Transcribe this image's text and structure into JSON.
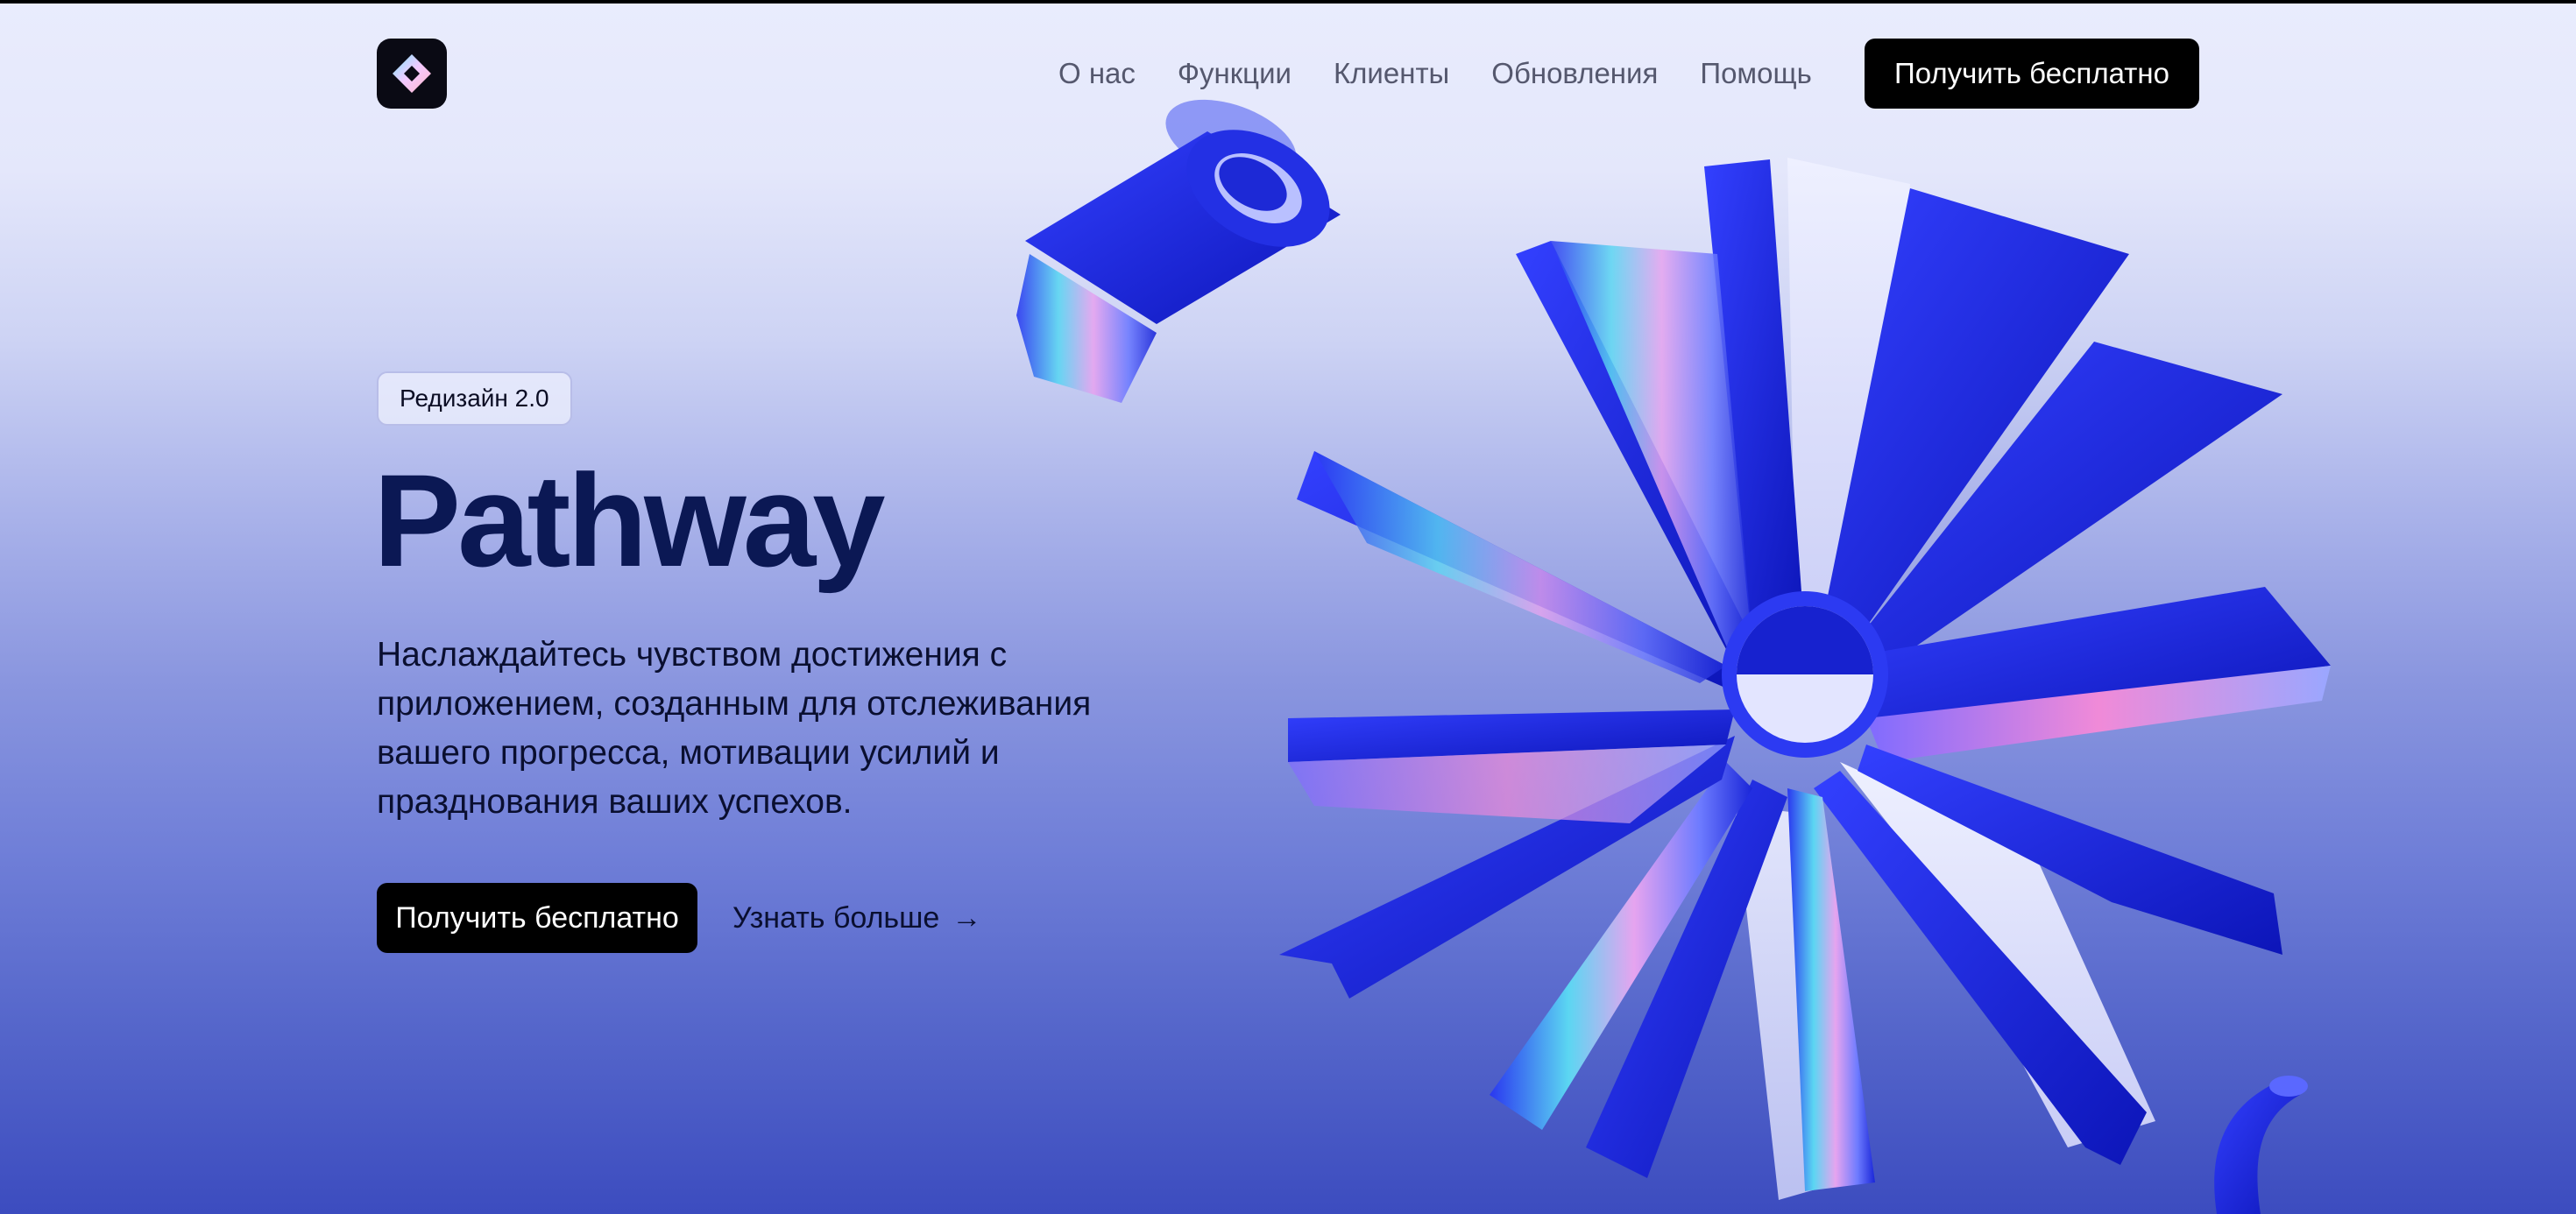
{
  "header": {
    "logo_icon": "diamond-logo-icon",
    "nav": [
      {
        "label": "О нас"
      },
      {
        "label": "Функции"
      },
      {
        "label": "Клиенты"
      },
      {
        "label": "Обновления"
      },
      {
        "label": "Помощь"
      }
    ],
    "cta_label": "Получить бесплатно"
  },
  "hero": {
    "badge": "Редизайн 2.0",
    "title": "Pathway",
    "subtitle": "Наслаждайтесь чувством достижения с приложением, созданным для отслеживания вашего прогресса, мотивации усилий и празднования ваших успехов.",
    "primary_cta": "Получить бесплатно",
    "secondary_cta": "Узнать больше",
    "secondary_icon": "arrow-right-icon"
  },
  "colors": {
    "accent_blue": "#1f2bd8",
    "title_navy": "#0b1854",
    "button_black": "#000000"
  }
}
